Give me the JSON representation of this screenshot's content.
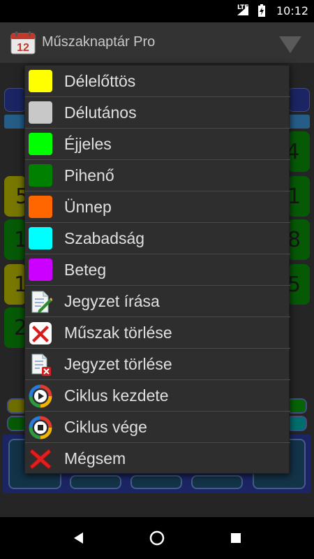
{
  "status_bar": {
    "time": "10:12",
    "network": "LTE"
  },
  "app_bar": {
    "title": "Műszaknaptár Pro",
    "icon_text": "12"
  },
  "background": {
    "left_numbers": [
      "5",
      "1",
      "1",
      "2"
    ],
    "right_numbers": [
      "4",
      "1",
      "8",
      "5"
    ]
  },
  "menu": {
    "items": [
      {
        "label": "Délelőttös",
        "color": "#ffff00"
      },
      {
        "label": "Délutános",
        "color": "#c8c8c8"
      },
      {
        "label": "Éjjeles",
        "color": "#00ff00"
      },
      {
        "label": "Pihenő",
        "color": "#008000"
      },
      {
        "label": "Ünnep",
        "color": "#ff6600"
      },
      {
        "label": "Szabadság",
        "color": "#00ffff"
      },
      {
        "label": "Beteg",
        "color": "#cc00ff"
      },
      {
        "label": "Jegyzet írása",
        "icon": "note-edit-icon"
      },
      {
        "label": "Műszak törlése",
        "icon": "delete-x-icon"
      },
      {
        "label": "Jegyzet törlése",
        "icon": "note-delete-icon"
      },
      {
        "label": "Ciklus kezdete",
        "icon": "cycle-start-icon"
      },
      {
        "label": "Ciklus vége",
        "icon": "cycle-stop-icon"
      },
      {
        "label": "Mégsem",
        "icon": "cancel-x-icon"
      }
    ]
  }
}
